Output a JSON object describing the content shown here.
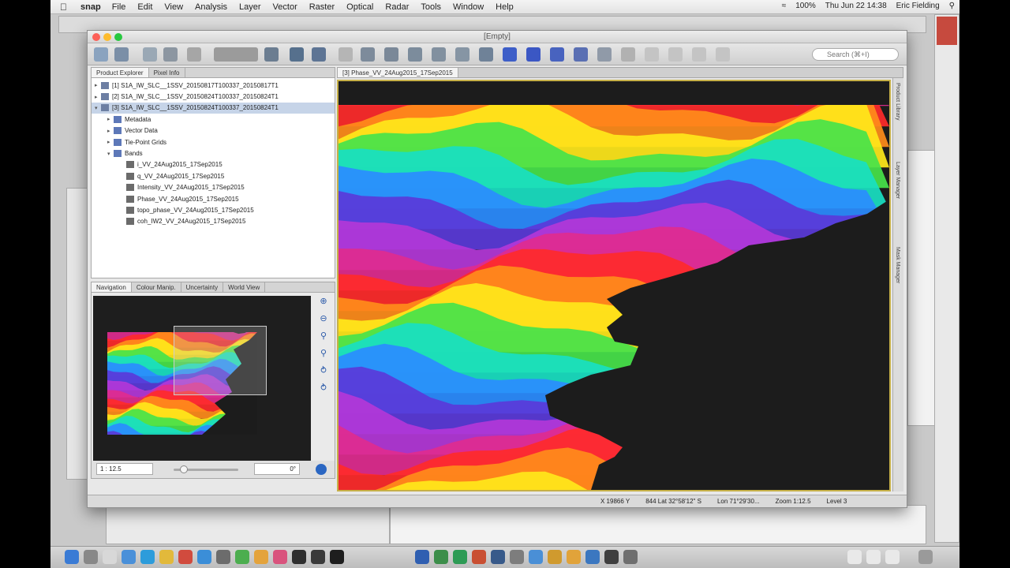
{
  "menubar": {
    "app": "snap",
    "items": [
      "File",
      "Edit",
      "View",
      "Analysis",
      "Layer",
      "Vector",
      "Raster",
      "Optical",
      "Radar",
      "Tools",
      "Window",
      "Help"
    ],
    "battery": "100%",
    "clock": "Thu Jun 22  14:38",
    "user": "Eric Fielding"
  },
  "window": {
    "title": "[Empty]"
  },
  "toolbar": {
    "search_placeholder": "Search (⌘+I)"
  },
  "left_panel": {
    "tabs": [
      "Product Explorer",
      "Pixel Info"
    ],
    "tree": [
      {
        "label": "[1] S1A_IW_SLC__1SSV_20150817T100337_20150817T1",
        "indent": 0,
        "expander": "▸",
        "icon": "product-icon",
        "selected": false
      },
      {
        "label": "[2] S1A_IW_SLC__1SSV_20150824T100337_20150824T1",
        "indent": 0,
        "expander": "▸",
        "icon": "product-icon",
        "selected": false
      },
      {
        "label": "[3] S1A_IW_SLC__1SSV_20150824T100337_20150824T1",
        "indent": 0,
        "expander": "▾",
        "icon": "product-icon",
        "selected": true
      },
      {
        "label": "Metadata",
        "indent": 1,
        "expander": "▸",
        "icon": "folder-icon",
        "selected": false
      },
      {
        "label": "Vector Data",
        "indent": 1,
        "expander": "▸",
        "icon": "folder-icon",
        "selected": false
      },
      {
        "label": "Tie-Point Grids",
        "indent": 1,
        "expander": "▸",
        "icon": "folder-icon",
        "selected": false
      },
      {
        "label": "Bands",
        "indent": 1,
        "expander": "▾",
        "icon": "folder-icon",
        "selected": false
      },
      {
        "label": "i_VV_24Aug2015_17Sep2015",
        "indent": 2,
        "expander": "",
        "icon": "band-icon",
        "selected": false
      },
      {
        "label": "q_VV_24Aug2015_17Sep2015",
        "indent": 2,
        "expander": "",
        "icon": "band-icon",
        "selected": false
      },
      {
        "label": "Intensity_VV_24Aug2015_17Sep2015",
        "indent": 2,
        "expander": "",
        "icon": "band-icon",
        "selected": false
      },
      {
        "label": "Phase_VV_24Aug2015_17Sep2015",
        "indent": 2,
        "expander": "",
        "icon": "band-icon",
        "selected": false
      },
      {
        "label": "topo_phase_VV_24Aug2015_17Sep2015",
        "indent": 2,
        "expander": "",
        "icon": "band-icon",
        "selected": false
      },
      {
        "label": "coh_IW2_VV_24Aug2015_17Sep2015",
        "indent": 2,
        "expander": "",
        "icon": "band-icon",
        "selected": false
      }
    ],
    "nav_tabs": [
      "Navigation",
      "Colour Manip.",
      "Uncertainty",
      "World View"
    ],
    "zoom_field": "1 : 12.5",
    "rotation_field": "0°"
  },
  "view": {
    "tab_label": "[3] Phase_VV_24Aug2015_17Sep2015",
    "right_rail": [
      "Product Library",
      "Layer Manager",
      "Mask Manager"
    ]
  },
  "status": {
    "x": "X  19866  Y",
    "lat": "844 Lat 32°58'12\" S",
    "lon": "Lon 71°29'30...",
    "zoom": "Zoom 1:12.5",
    "level": "Level 3"
  },
  "colors": {
    "viewport_border": "#c6b048",
    "selection": "#c6d4e8",
    "no_data": "#1c1c1c"
  }
}
